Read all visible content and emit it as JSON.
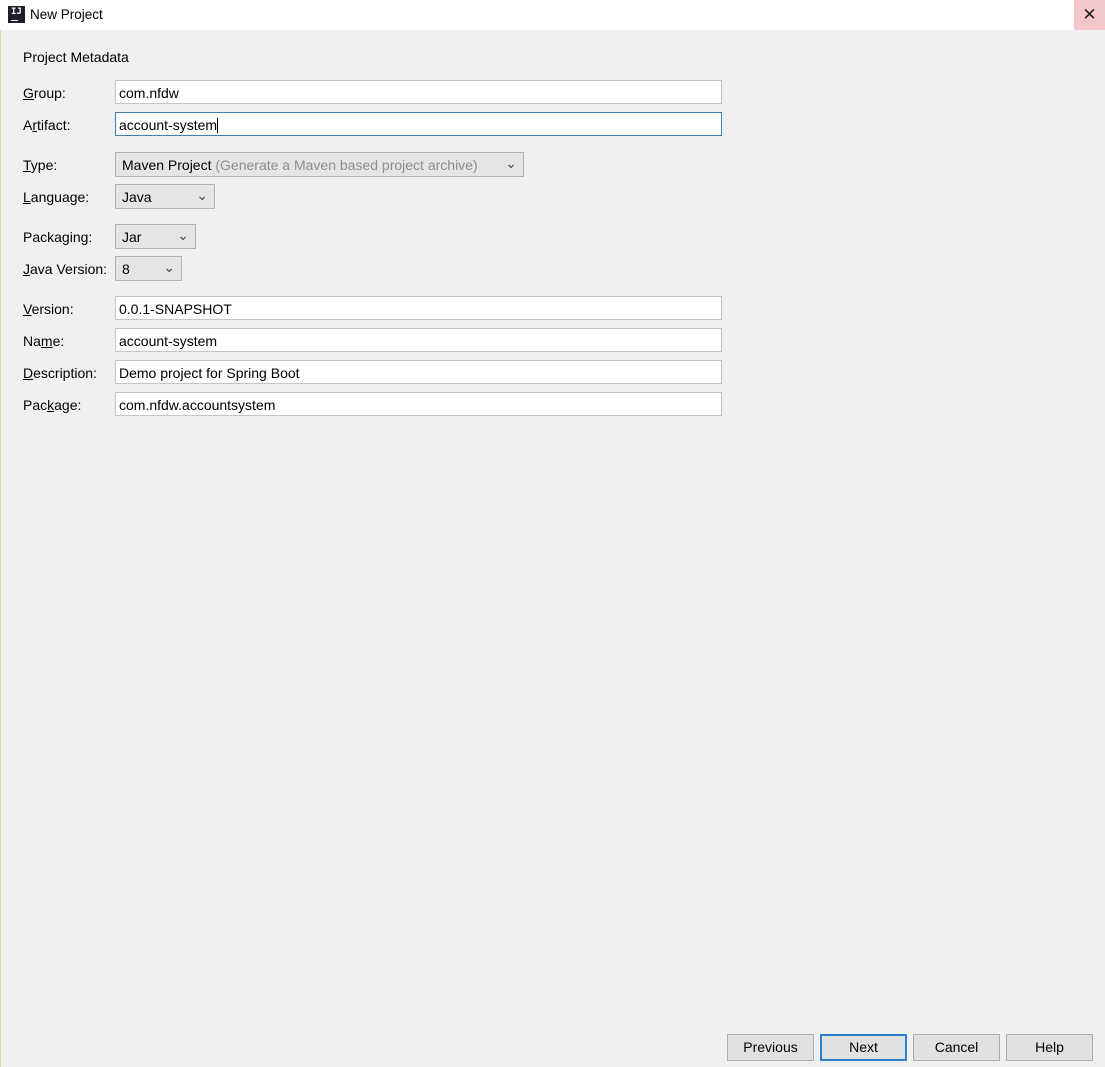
{
  "window": {
    "title": "New Project",
    "app_icon_text": "IJ",
    "close_glyph": "✕"
  },
  "section": {
    "title": "Project Metadata"
  },
  "fields": {
    "group": {
      "label_mnemonic": "G",
      "label_rest": "roup:",
      "value": "com.nfdw"
    },
    "artifact": {
      "label_pre": "A",
      "label_mnemonic": "r",
      "label_rest": "tifact:",
      "value": "account-system"
    },
    "type": {
      "label_mnemonic": "T",
      "label_rest": "ype:",
      "value": "Maven Project",
      "hint": "(Generate a Maven based project archive)"
    },
    "language": {
      "label_mnemonic": "L",
      "label_rest": "anguage:",
      "value": "Java"
    },
    "packaging": {
      "label_pre": "Packa",
      "label_mnemonic": "g",
      "label_rest": "ing:",
      "value": "Jar"
    },
    "java_version": {
      "label_mnemonic": "J",
      "label_rest": "ava Version:",
      "value": "8"
    },
    "version": {
      "label_mnemonic": "V",
      "label_rest": "ersion:",
      "value": "0.0.1-SNAPSHOT"
    },
    "name": {
      "label_pre": "Na",
      "label_mnemonic": "m",
      "label_rest": "e:",
      "value": "account-system"
    },
    "description": {
      "label_mnemonic": "D",
      "label_rest": "escription:",
      "value": "Demo project for Spring Boot"
    },
    "package": {
      "label_pre": "Pac",
      "label_mnemonic": "k",
      "label_rest": "age:",
      "value": "com.nfdw.accountsystem"
    }
  },
  "buttons": {
    "previous": "Previous",
    "next": "Next",
    "cancel": "Cancel",
    "help": "Help"
  },
  "icons": {
    "dropdown": "chevron-down-icon",
    "close": "close-icon",
    "app": "intellij-icon"
  },
  "colors": {
    "focus_border": "#3c7fb1",
    "default_button_border": "#2f7fd0",
    "close_bg": "#f4c7cc"
  }
}
